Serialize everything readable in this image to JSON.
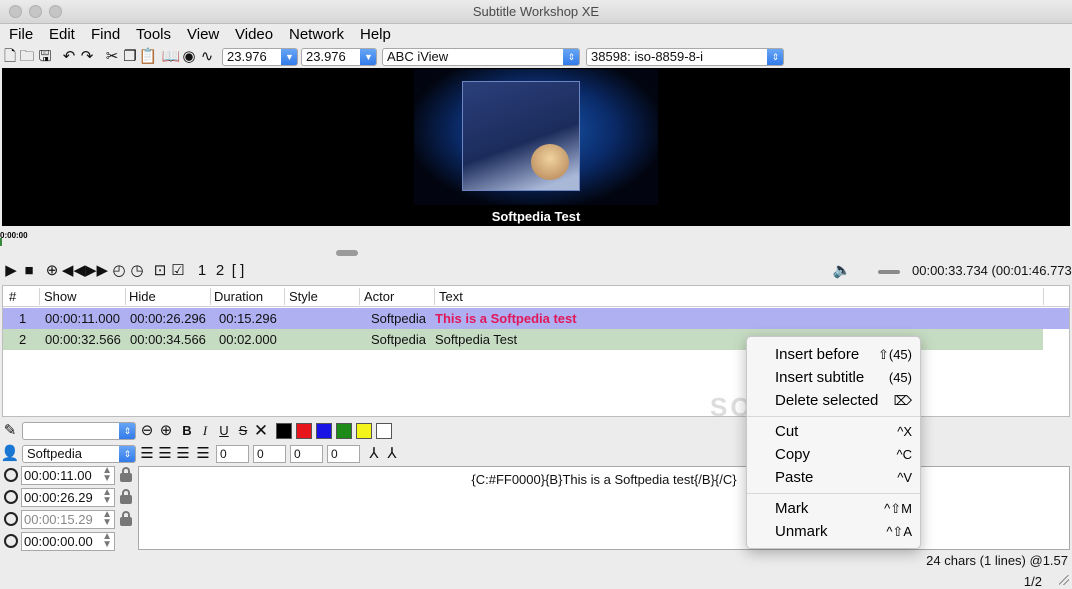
{
  "window": {
    "title": "Subtitle Workshop XE"
  },
  "menu": [
    "File",
    "Edit",
    "Find",
    "Tools",
    "View",
    "Video",
    "Network",
    "Help"
  ],
  "toolbar": {
    "fps_input": "23.976",
    "fps_output": "23.976",
    "format": "ABC iView",
    "encoding": "38598: iso-8859-8-i"
  },
  "video": {
    "caption": "Softpedia Test",
    "timeline_time": "0:00:00"
  },
  "player": {
    "position": "00:00:33.734",
    "duration": "(00:01:46.773"
  },
  "grid": {
    "headers": [
      "#",
      "Show",
      "Hide",
      "Duration",
      "Style",
      "Actor",
      "Text"
    ],
    "rows": [
      {
        "num": "1",
        "show": "00:00:11.000",
        "hide": "00:00:26.296",
        "duration": "00:15.296",
        "style": "",
        "actor": "Softpedia",
        "text": "This is a Softpedia test"
      },
      {
        "num": "2",
        "show": "00:00:32.566",
        "hide": "00:00:34.566",
        "duration": "00:02.000",
        "style": "",
        "actor": "Softpedia",
        "text": "Softpedia Test"
      }
    ]
  },
  "editor": {
    "style_combo": "",
    "actor_combo": "Softpedia",
    "margins": [
      "0",
      "0",
      "0",
      "0"
    ],
    "swatches": [
      "#000000",
      "#e8141b",
      "#1a13e6",
      "#1e8a18",
      "#f4f41a",
      "#ffffff"
    ],
    "show_time": "00:00:11.00",
    "hide_time": "00:00:26.29",
    "duration_time": "00:00:15.29",
    "pause_time": "00:00:00.00",
    "text": "{C:#FF0000}{B}This is a Softpedia test{/B}{/C}"
  },
  "status": {
    "stats": "24 chars (1 lines) @1.57",
    "page": "1/2"
  },
  "context_menu": [
    {
      "label": "Insert before",
      "shortcut": "⇧(45)"
    },
    {
      "label": "Insert subtitle",
      "shortcut": "(45)"
    },
    {
      "label": "Delete selected",
      "shortcut": "⌦"
    },
    {
      "label": "Cut",
      "shortcut": "^X"
    },
    {
      "label": "Copy",
      "shortcut": "^C"
    },
    {
      "label": "Paste",
      "shortcut": "^V"
    },
    {
      "label": "Mark",
      "shortcut": "^⇧M"
    },
    {
      "label": "Unmark",
      "shortcut": "^⇧A"
    }
  ],
  "watermark": "SOFTPEDIA"
}
